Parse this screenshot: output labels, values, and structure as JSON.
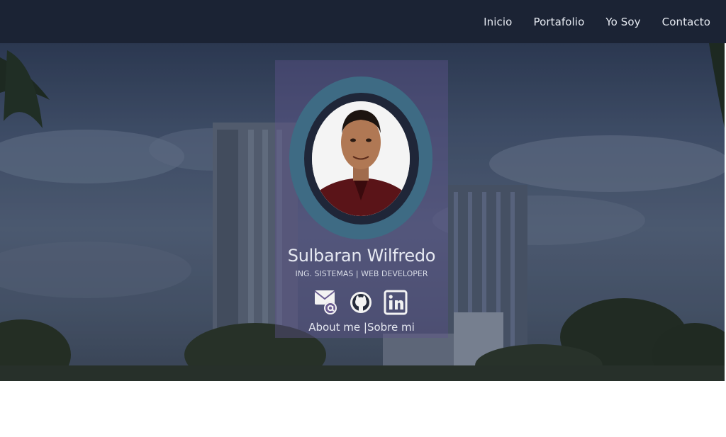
{
  "nav": {
    "items": [
      {
        "label": "Inicio"
      },
      {
        "label": "Portafolio"
      },
      {
        "label": "Yo Soy"
      },
      {
        "label": "Contacto"
      }
    ]
  },
  "profile": {
    "name": "Sulbaran Wilfredo",
    "role": "ING. SISTEMAS | WEB DEVELOPER",
    "about_link": "About me |Sobre mi",
    "social": [
      {
        "icon": "mail-at-icon"
      },
      {
        "icon": "github-icon"
      },
      {
        "icon": "linkedin-icon"
      }
    ]
  },
  "colors": {
    "navbar": "#1b2334",
    "card": "#60548c",
    "avatar_ring": "#3e6b84",
    "avatar_frame": "#1f2638"
  }
}
